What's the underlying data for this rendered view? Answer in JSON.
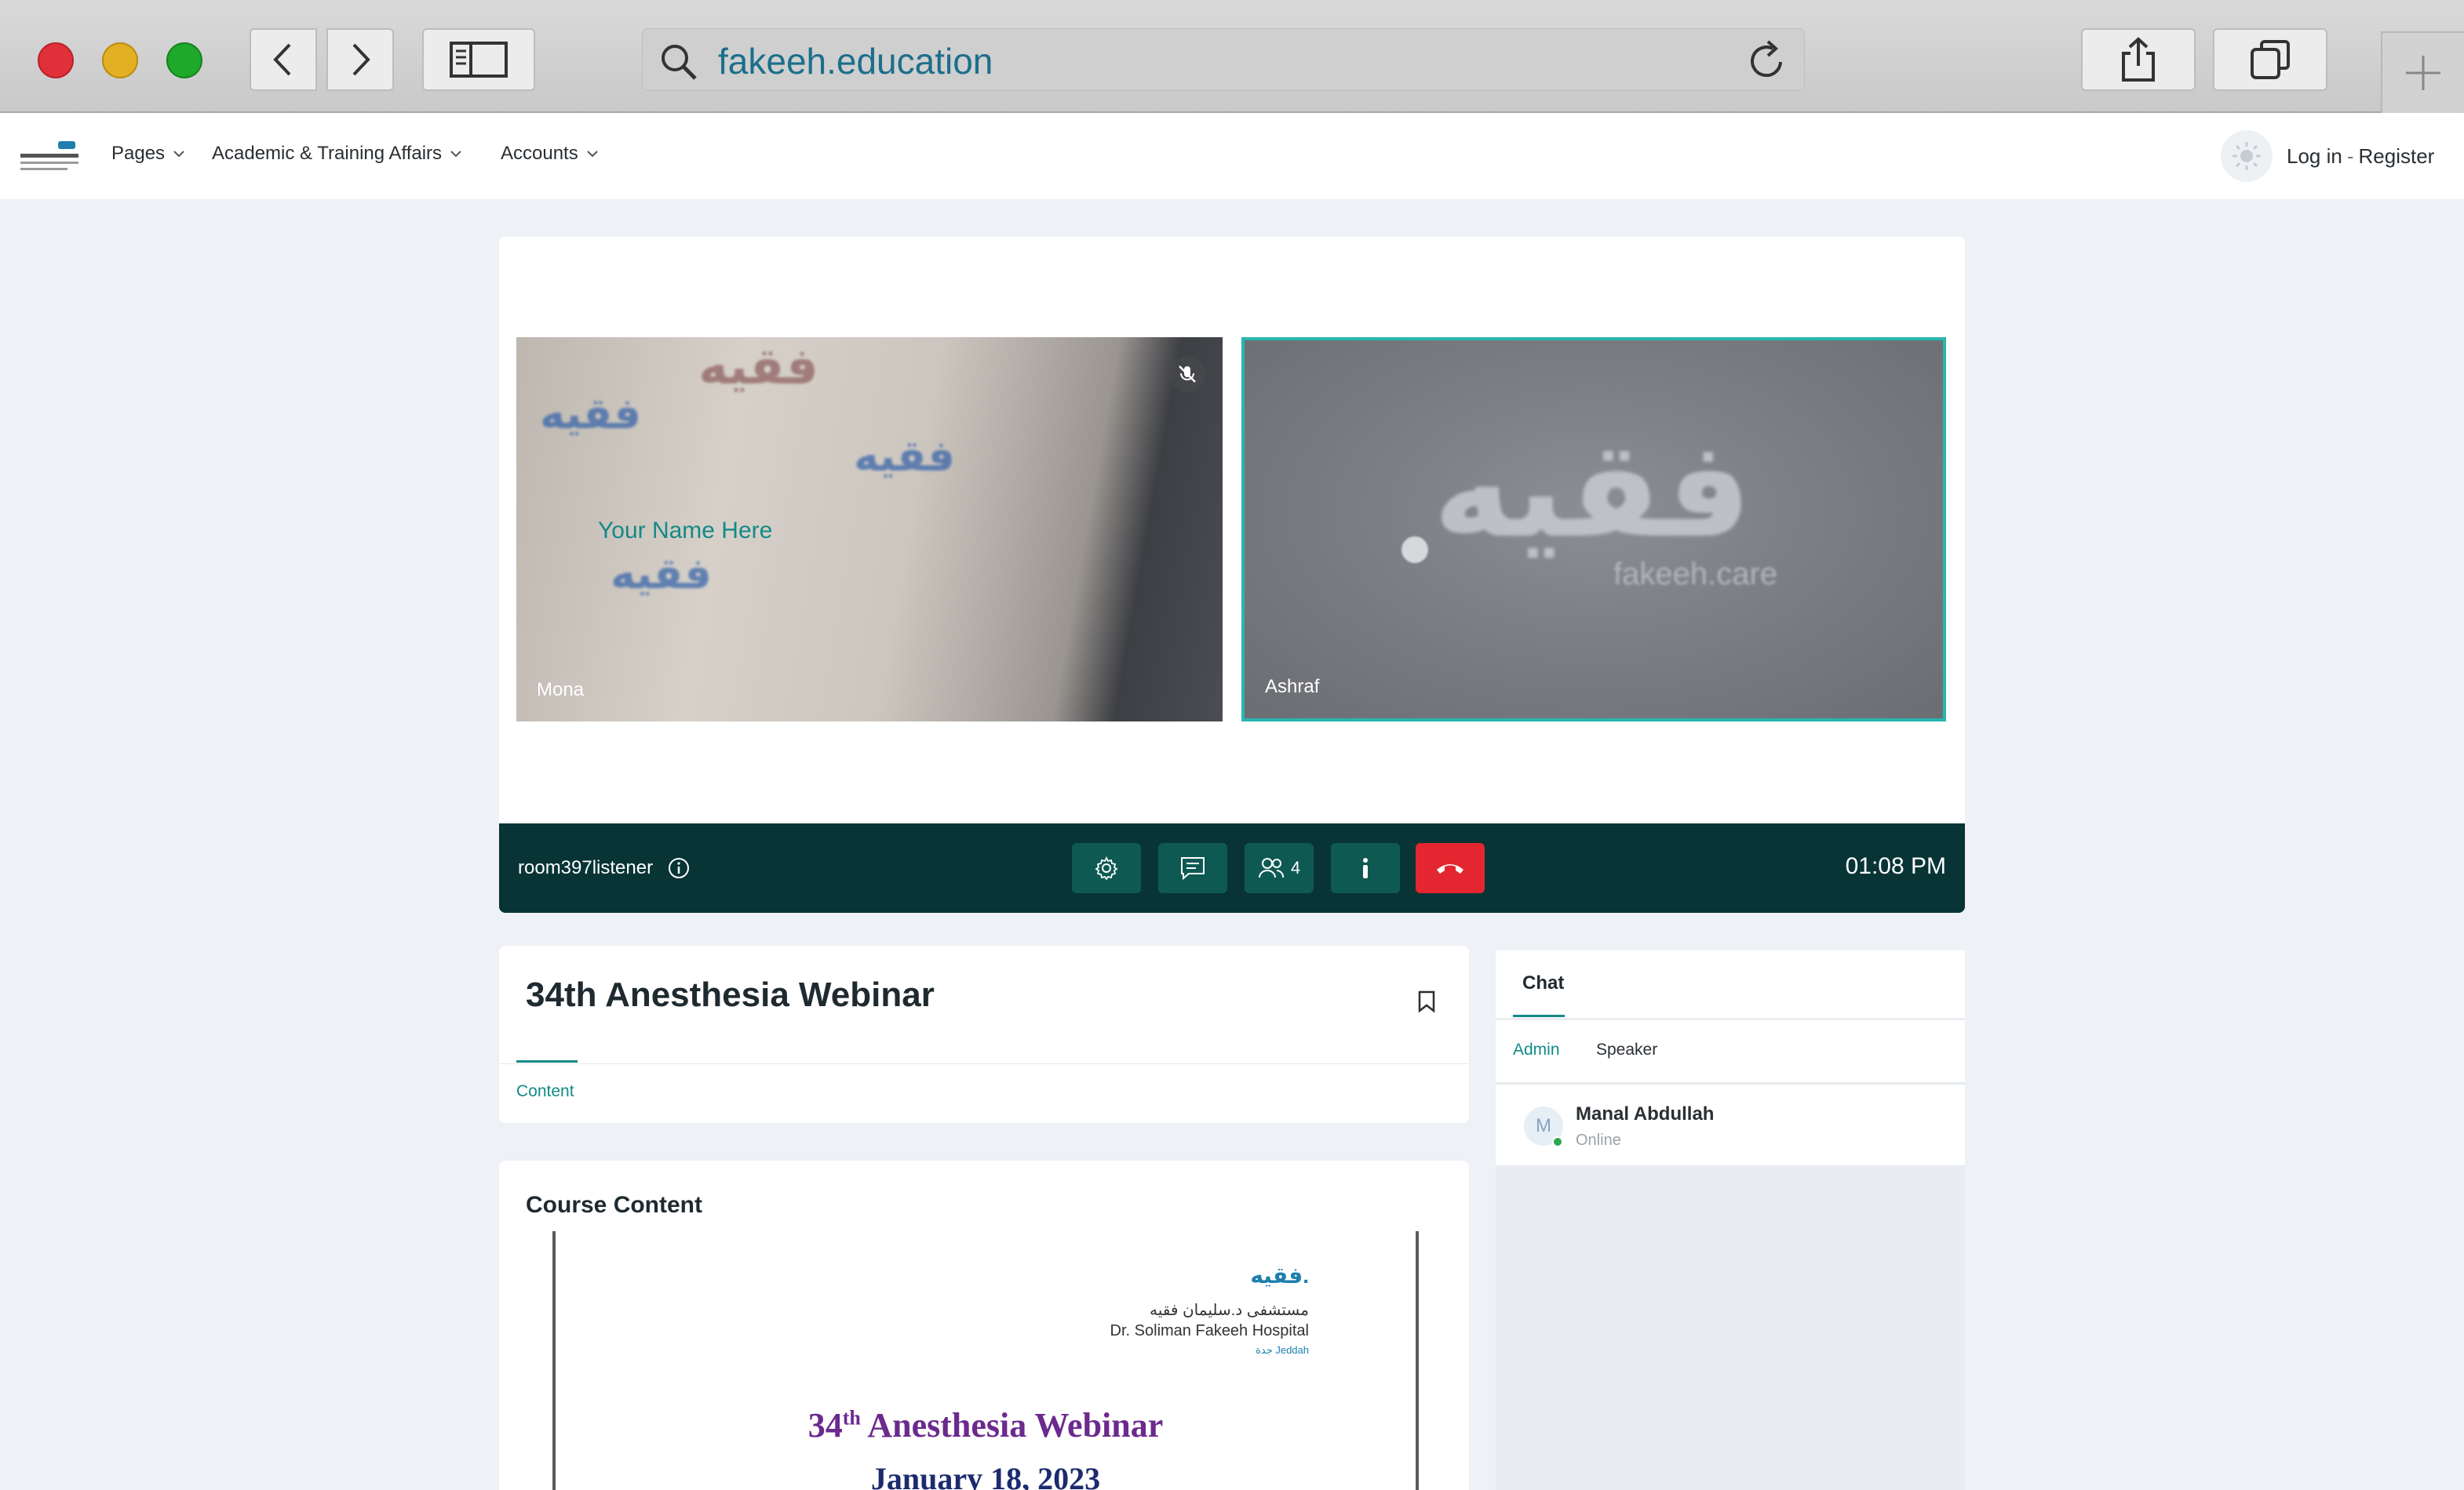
{
  "browser": {
    "url": "fakeeh.education"
  },
  "nav": {
    "items": [
      {
        "label": "Pages"
      },
      {
        "label": "Academic & Training Affairs"
      },
      {
        "label": "Accounts"
      }
    ],
    "login": "Log in",
    "separator": "-",
    "register": "Register"
  },
  "video": {
    "tiles": [
      {
        "name": "Mona",
        "muted": true
      },
      {
        "name": "Ashraf",
        "active": true
      }
    ],
    "overlay_name": "Your Name Here",
    "tile1_text": [
      "فقيه",
      "فقيه",
      "فقيه",
      "فقيه"
    ],
    "tile2_text": [
      "فقيه",
      "fakeeh.care"
    ]
  },
  "controls": {
    "room": "room397listener",
    "participants_count": "4",
    "time": "01:08 PM",
    "accent": "#0e5a53",
    "hangup_color": "#e3262f"
  },
  "webinar": {
    "title": "34th Anesthesia Webinar",
    "tab": "Content"
  },
  "course": {
    "title": "Course Content",
    "doc_logo": "فقيه.",
    "doc_ar": "مستشفى د.سليمان فقيه",
    "doc_en": "Dr. Soliman Fakeeh Hospital",
    "doc_city": "جدة Jeddah",
    "doc_heading_num": "34",
    "doc_heading_sup": "th",
    "doc_heading_rest": " Anesthesia Webinar",
    "doc_date": "January 18, 2023"
  },
  "chat": {
    "tab": "Chat",
    "subtabs": [
      "Admin",
      "Speaker"
    ],
    "users": [
      {
        "initial": "M",
        "name": "Manal Abdullah",
        "status": "Online"
      }
    ]
  }
}
